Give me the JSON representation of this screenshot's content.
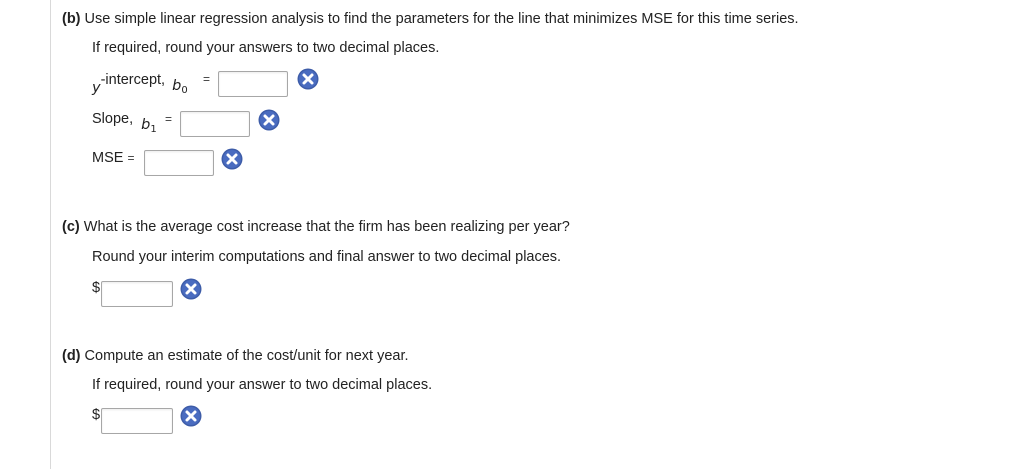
{
  "part_b": {
    "marker": "(b)",
    "question": "Use simple linear regression analysis to find the parameters for the line that minimizes MSE for this time series.",
    "note": "If required, round your answers to two decimal places.",
    "y_intercept_label": "-intercept,",
    "y_symbol": "y",
    "b0_symbol": "b",
    "b0_sub": "0",
    "slope_label": "Slope,",
    "b1_symbol": "b",
    "b1_sub": "1",
    "mse_label": "MSE",
    "equals": "=",
    "y_intercept_value": "",
    "slope_value": "",
    "mse_value": ""
  },
  "part_c": {
    "marker": "(c)",
    "question": "What is the average cost increase that the firm has been realizing per year?",
    "note": "Round your interim computations and final answer to two decimal places.",
    "currency": "$",
    "value": ""
  },
  "part_d": {
    "marker": "(d)",
    "question": "Compute an estimate of the cost/unit for next year.",
    "note": "If required, round your answer to two decimal places.",
    "currency": "$",
    "value": ""
  },
  "icons": {
    "incorrect": "incorrect-x-icon",
    "color": "#3d5ca8"
  }
}
